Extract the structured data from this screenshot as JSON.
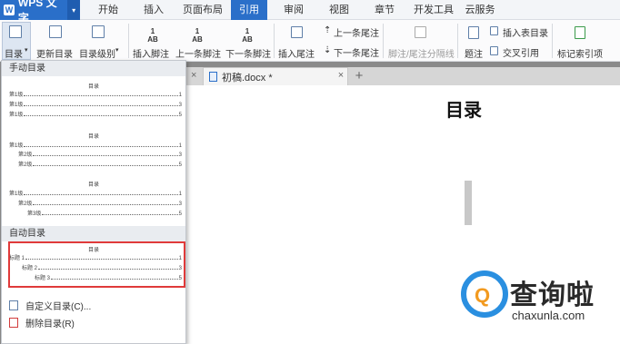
{
  "app": {
    "name": "WPS 文字",
    "logo_letter": "W"
  },
  "menu_tabs": [
    "开始",
    "插入",
    "页面布局",
    "引用",
    "审阅",
    "视图",
    "章节",
    "开发工具",
    "云服务"
  ],
  "active_tab": "引用",
  "ribbon": {
    "toc": "目录",
    "update_toc": "更新目录",
    "toc_level": "目录级别",
    "insert_footnote": "插入脚注",
    "prev_footnote": "上一条脚注",
    "next_footnote": "下一条脚注",
    "insert_endnote": "插入尾注",
    "prev_endnote": "上一条尾注",
    "next_endnote": "下一条尾注",
    "footnote_separator": "脚注/尾注分隔线",
    "caption": "题注",
    "insert_table_of_figures": "插入表目录",
    "cross_reference": "交叉引用",
    "mark_index_entry": "标记索引项",
    "ab_label": "AB",
    "ab_sup": "1"
  },
  "document": {
    "tab_title": "初稿.docx *",
    "close_glyph": "×",
    "new_tab_glyph": "+",
    "heading": "目录"
  },
  "dropdown": {
    "manual_section": "手动目录",
    "auto_section": "自动目录",
    "preview_title": "目录",
    "manual_previews": [
      {
        "lines": [
          {
            "label": "第1级",
            "page": "1"
          },
          {
            "label": "第1级",
            "page": "3"
          },
          {
            "label": "第1级",
            "page": "5"
          }
        ]
      },
      {
        "lines": [
          {
            "label": "第1级",
            "page": "1"
          },
          {
            "label": "第2级",
            "page": "3"
          },
          {
            "label": "第2级",
            "page": "5"
          }
        ]
      },
      {
        "lines": [
          {
            "label": "第1级",
            "page": "1"
          },
          {
            "label": "第2级",
            "page": "3"
          },
          {
            "label": "第3级",
            "page": "5"
          }
        ]
      }
    ],
    "auto_preview": {
      "lines": [
        {
          "label": "标题 1",
          "page": "1"
        },
        {
          "label": "标题 2",
          "page": "3"
        },
        {
          "label": "标题 3",
          "page": "5"
        }
      ]
    },
    "custom_toc": "自定义目录(C)...",
    "delete_toc": "删除目录(R)"
  },
  "watermark": {
    "title": "查询啦",
    "domain": "chaxunla.com",
    "letter": "Q"
  },
  "colors": {
    "brand_blue": "#2a6fc9",
    "highlight_red": "#e03a3a",
    "watermark_orange": "#f29a1f"
  }
}
